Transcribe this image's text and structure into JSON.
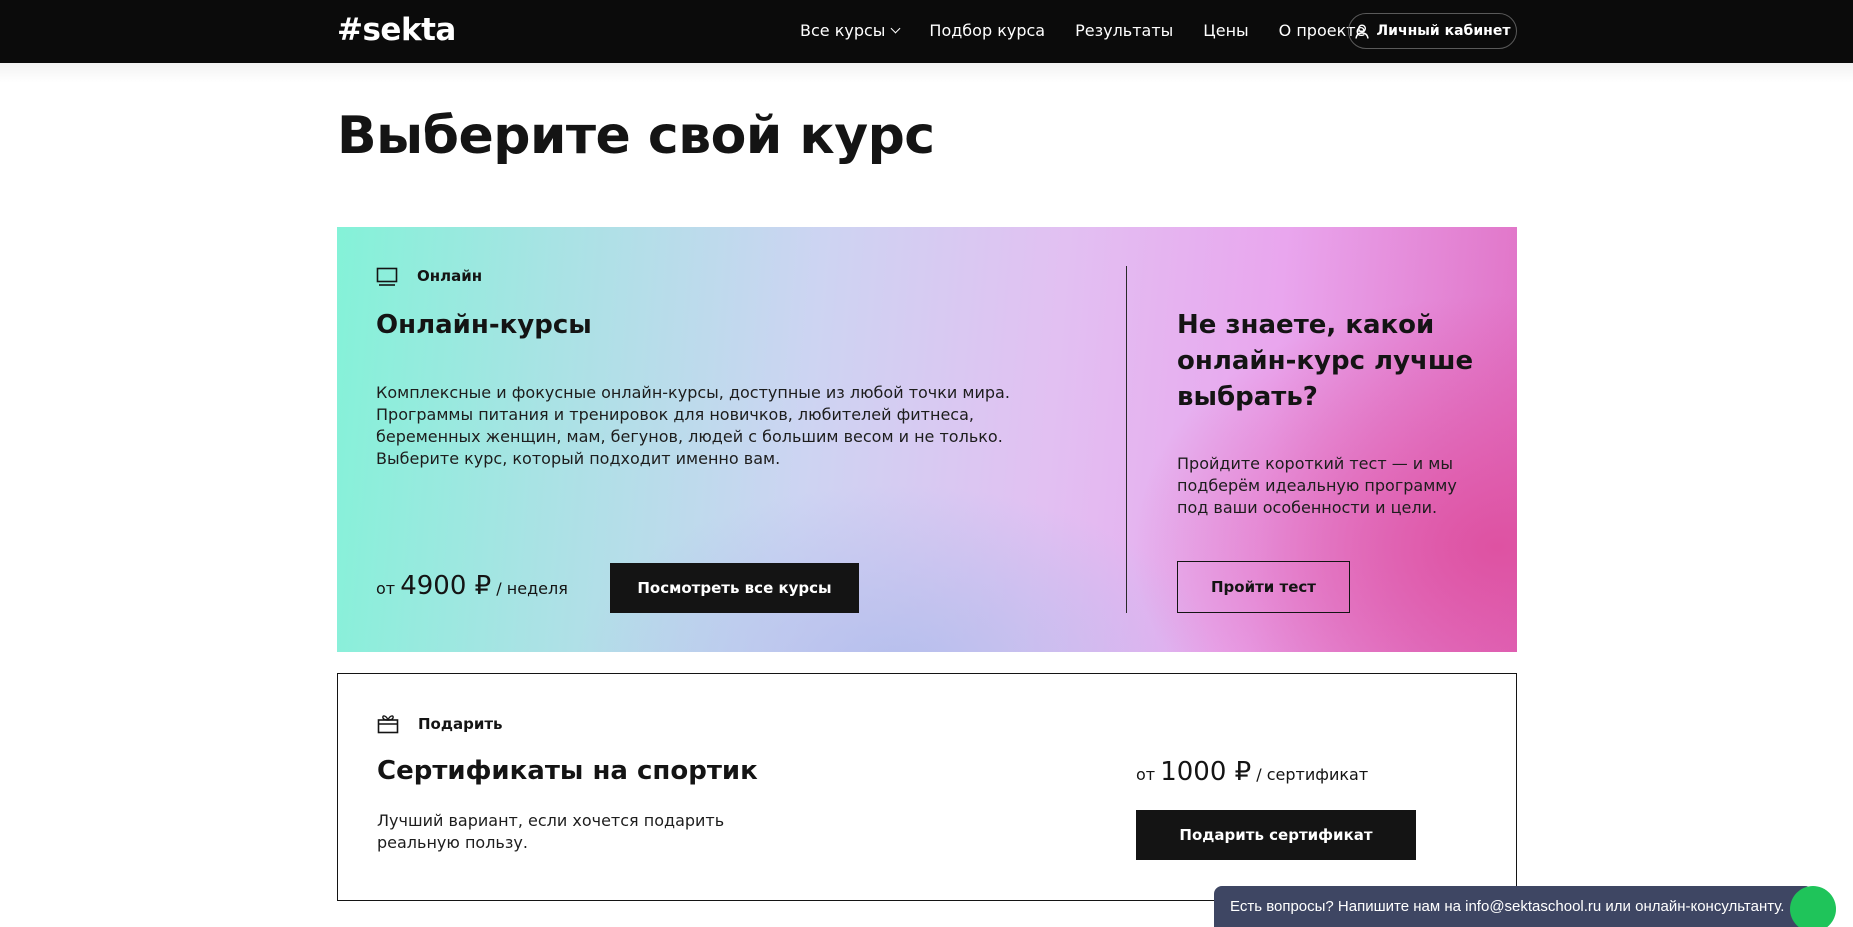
{
  "header": {
    "logo": "#sekta",
    "nav": [
      {
        "label": "Все курсы"
      },
      {
        "label": "Подбор курса"
      },
      {
        "label": "Результаты"
      },
      {
        "label": "Цены"
      },
      {
        "label": "О проекте"
      }
    ],
    "account_label": "Личный кабинет"
  },
  "page": {
    "title": "Выберите свой курс"
  },
  "online": {
    "tag": "Онлайн",
    "title": "Онлайн-курсы",
    "description": "Комплексные и фокусные онлайн-курсы, доступные из любой точки мира. Программы питания и тренировок для новичков, любителей фитнеса, беременных женщин, мам, бегунов, людей с большим весом и не только. Выберите курс, который подходит именно вам.",
    "price_prefix": "от",
    "price_amount": "4900 ₽",
    "price_suffix": "/ неделя",
    "button_label": "Посмотреть все курсы"
  },
  "quiz": {
    "title": "Не знаете, какой онлайн-курс лучше выбрать?",
    "description": "Пройдите короткий тест — и мы подберём идеальную программу под ваши особенности и цели.",
    "button_label": "Пройти тест"
  },
  "gift": {
    "tag": "Подарить",
    "title": "Сертификаты на спортик",
    "description": "Лучший вариант, если хочется подарить реальную пользу.",
    "price_prefix": "от",
    "price_amount": "1000 ₽",
    "price_suffix": "/ сертификат",
    "button_label": "Подарить сертификат"
  },
  "chat": {
    "text": "Есть вопросы? Напишите нам на info@sektaschool.ru или онлайн-консультанту."
  },
  "colors": {
    "header_bg": "#0b0b0b",
    "button_dark": "#141414",
    "chat_bg": "#3e4663",
    "chat_bubble": "#1fc45a"
  }
}
